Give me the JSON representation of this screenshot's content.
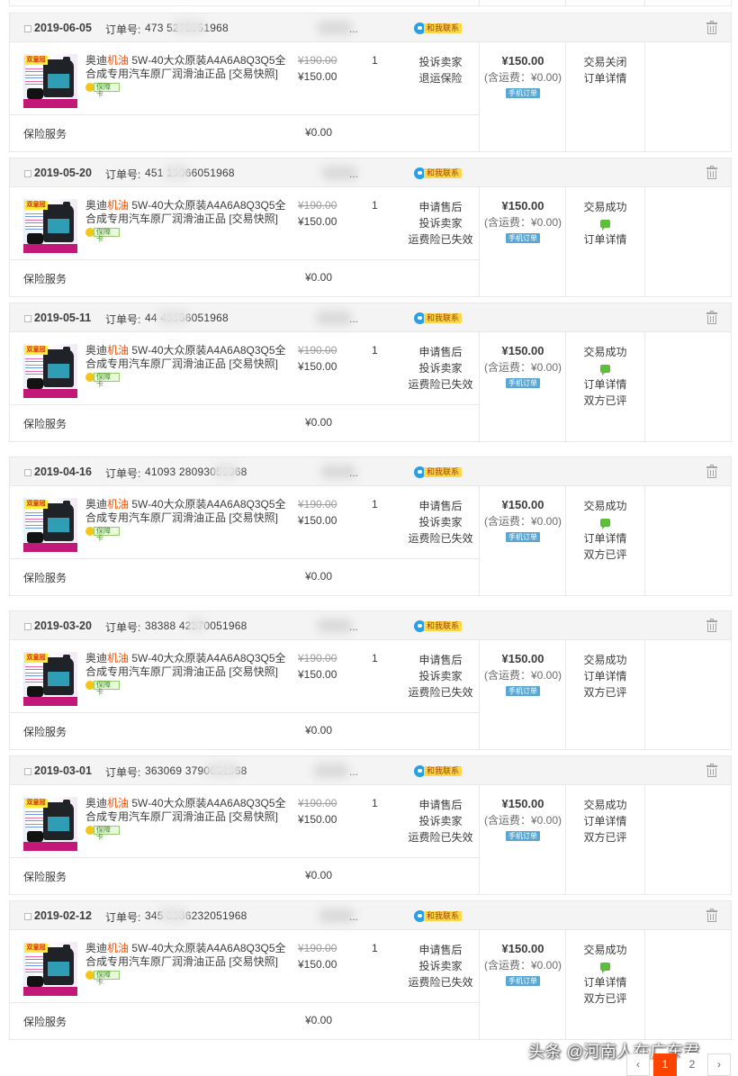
{
  "product": {
    "title_prefix": "奥迪",
    "title_highlight": "机油",
    "title_suffix": " 5W-40大众原装A4A6A8Q3Q5全合成专用汽车原厂润滑油正品 [交易快照]",
    "badge_text": "保障卡",
    "thumb_badge": "双皇冠",
    "price_original": "¥190.00",
    "price_current": "¥150.00",
    "quantity": "1"
  },
  "labels": {
    "order_no": "订单号:",
    "contact": "和我联系",
    "shipping": "(含运费：¥0.00)",
    "mobile_order": "手机订单",
    "insurance": "保险服务",
    "insurance_amount": "¥0.00",
    "shop_dots": "..."
  },
  "orders": [
    {
      "date": "2019-06-05",
      "order_no": "473     5278051968",
      "total": "¥150.00",
      "actions": [
        "投诉卖家",
        "退运保险"
      ],
      "status": [
        "交易关闭",
        "订单详情"
      ],
      "wechat": false
    },
    {
      "date": "2019-05-20",
      "order_no": "451     19066051968",
      "total": "¥150.00",
      "actions": [
        "申请售后",
        "投诉卖家",
        "运费险已失效"
      ],
      "status": [
        "交易成功",
        "订单详情"
      ],
      "wechat": true
    },
    {
      "date": "2019-05-11",
      "order_no": "44      43556051968",
      "total": "¥150.00",
      "actions": [
        "申请售后",
        "投诉卖家",
        "运费险已失效"
      ],
      "status": [
        "交易成功",
        "订单详情",
        "双方已评"
      ],
      "wechat": true
    },
    {
      "date": "2019-04-16",
      "order_no": "41093   28093051968",
      "total": "¥150.00",
      "actions": [
        "申请售后",
        "投诉卖家",
        "运费险已失效"
      ],
      "status": [
        "交易成功",
        "订单详情",
        "双方已评"
      ],
      "wechat": true
    },
    {
      "date": "2019-03-20",
      "order_no": "38388   42370051968",
      "total": "¥150.00",
      "actions": [
        "申请售后",
        "投诉卖家",
        "运费险已失效"
      ],
      "status": [
        "交易成功",
        "订单详情",
        "双方已评"
      ],
      "wechat": false
    },
    {
      "date": "2019-03-01",
      "order_no": "363069  3790051968",
      "total": "¥150.00",
      "actions": [
        "申请售后",
        "投诉卖家",
        "运费险已失效"
      ],
      "status": [
        "交易成功",
        "订单详情",
        "双方已评"
      ],
      "wechat": false
    },
    {
      "date": "2019-02-12",
      "order_no": "345     6386232051968",
      "total": "¥150.00",
      "actions": [
        "申请售后",
        "投诉卖家",
        "运费险已失效"
      ],
      "status": [
        "交易成功",
        "订单详情",
        "双方已评"
      ],
      "wechat": true
    }
  ],
  "watermark": "头条 @河南人在广东君",
  "pagination": {
    "prev": "‹",
    "pages": [
      "1",
      "2"
    ],
    "current": "1",
    "next": "›"
  },
  "colors": {
    "accent": "#ff5000",
    "pager_active": "#ff4400",
    "header_bg": "#f4f4f4",
    "border": "#e8e8e8"
  }
}
